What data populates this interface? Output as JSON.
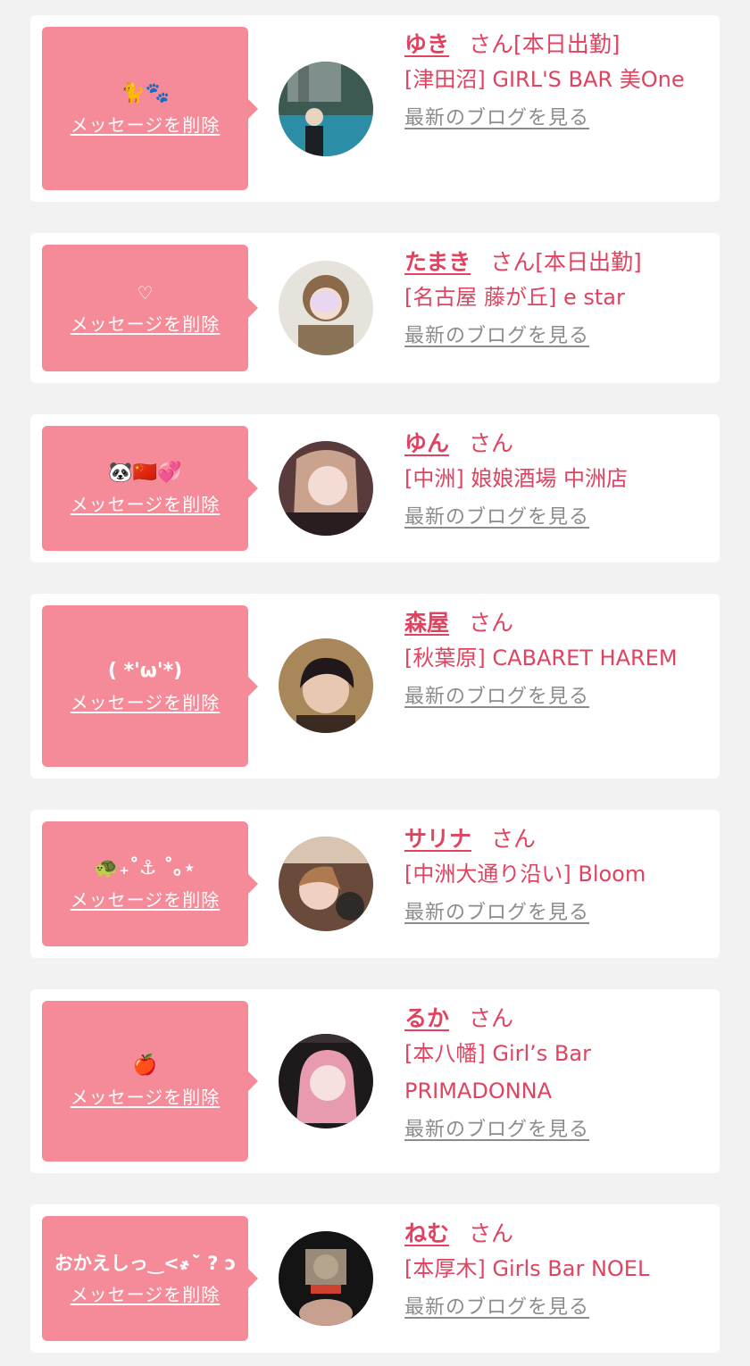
{
  "messages": [
    {
      "message": "🐈🐾",
      "delete_label": "メッセージを削除",
      "name": "ゆき",
      "honorific": "さん",
      "status": "[本日出勤]",
      "shop": "[津田沼] GIRL'S BAR 美One",
      "blog_label": "最新のブログを見る"
    },
    {
      "message": "♡",
      "delete_label": "メッセージを削除",
      "name": "たまき",
      "honorific": "さん",
      "status": "[本日出勤]",
      "shop": "[名古屋 藤が丘] e star",
      "blog_label": "最新のブログを見る"
    },
    {
      "message": "🐼🇨🇳💞",
      "delete_label": "メッセージを削除",
      "name": "ゆん",
      "honorific": "さん",
      "status": "",
      "shop": "[中洲] 娘娘酒場 中洲店",
      "blog_label": "最新のブログを見る"
    },
    {
      "message": "( *'ω'*)",
      "delete_label": "メッセージを削除",
      "name": "森屋",
      "honorific": "さん",
      "status": "",
      "shop": "[秋葉原] CABARET HAREM",
      "blog_label": "最新のブログを見る"
    },
    {
      "message": "🐢₊˚⚓︎ ˚｡⋆",
      "delete_label": "メッセージを削除",
      "name": "サリナ",
      "honorific": "さん",
      "status": "",
      "shop": "[中洲大通り沿い] Bloom",
      "blog_label": "最新のブログを見る"
    },
    {
      "message": "🍎",
      "delete_label": "メッセージを削除",
      "name": "るか",
      "honorific": "さん",
      "status": "",
      "shop": "[本八幡] Girl’s Bar PRIMADONNA",
      "blog_label": "最新のブログを見る"
    },
    {
      "message": "おかえしっ‿<҂˘̀ ? ɔ",
      "delete_label": "メッセージを削除",
      "name": "ねむ",
      "honorific": "さん",
      "status": "",
      "shop": "[本厚木] Girls Bar NOEL",
      "blog_label": "最新のブログを見る"
    }
  ],
  "colors": {
    "bubble": "#f58b98",
    "name": "#e0435f",
    "blog_link": "#8c8c8c",
    "background": "#f2f2f2"
  }
}
